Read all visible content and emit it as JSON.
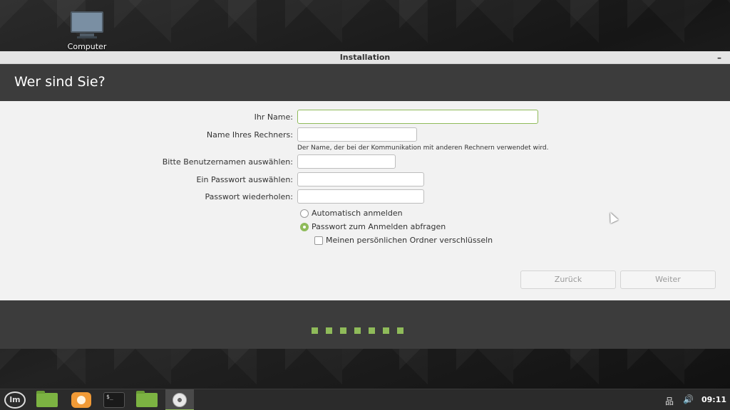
{
  "desktop": {
    "icon_label": "Computer"
  },
  "window": {
    "title": "Installation",
    "minimize_glyph": "–",
    "heading": "Wer sind Sie?"
  },
  "form": {
    "name_label": "Ihr Name:",
    "name_value": "",
    "computer_label": "Name Ihres Rechners:",
    "computer_value": "",
    "computer_hint": "Der Name, der bei der Kommunikation mit anderen Rechnern verwendet wird.",
    "username_label": "Bitte Benutzernamen auswählen:",
    "username_value": "",
    "password_label": "Ein Passwort auswählen:",
    "password_value": "",
    "password_repeat_label": "Passwort wiederholen:",
    "password_repeat_value": "",
    "auto_login_label": "Automatisch anmelden",
    "auto_login_checked": false,
    "require_password_label": "Passwort zum Anmelden abfragen",
    "require_password_checked": true,
    "encrypt_home_label": "Meinen persönlichen Ordner verschlüsseln",
    "encrypt_home_checked": false
  },
  "buttons": {
    "back_label": "Zurück",
    "next_label": "Weiter"
  },
  "progress": {
    "steps_total": 7
  },
  "taskbar": {
    "mint_logo_text": "lm",
    "terminal_text": "$_",
    "clock": "09:11",
    "network_glyph": "品",
    "volume_glyph": "🔊"
  },
  "colors": {
    "accent": "#8fbb5a",
    "header_bg": "#3c3c3c",
    "content_bg": "#f2f2f2"
  }
}
